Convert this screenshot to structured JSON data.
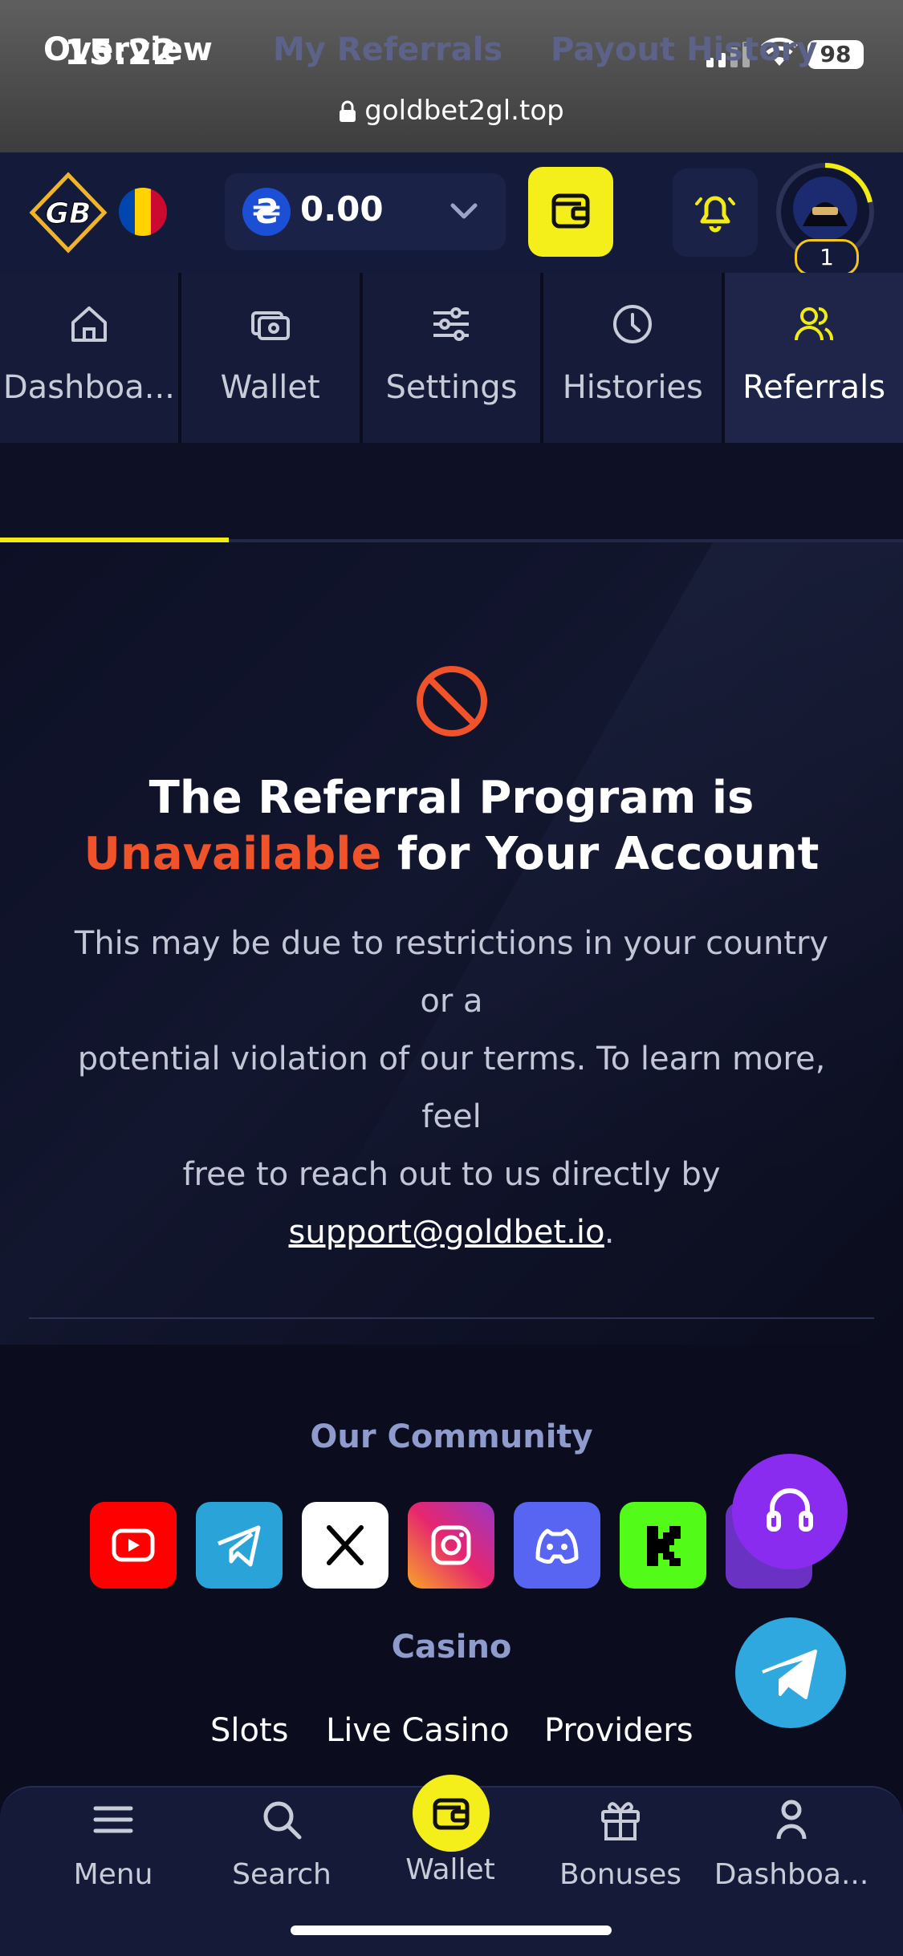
{
  "status": {
    "time": "15:22",
    "battery": "98",
    "url": "goldbet2gl.top"
  },
  "header": {
    "balance": "0.00",
    "currency_symbol": "₴",
    "level": "1"
  },
  "nav_tabs": [
    {
      "label": "Dashboa..."
    },
    {
      "label": "Wallet"
    },
    {
      "label": "Settings"
    },
    {
      "label": "Histories"
    },
    {
      "label": "Referrals"
    }
  ],
  "sub_tabs": [
    {
      "label": "Overview"
    },
    {
      "label": "My Referrals"
    },
    {
      "label": "Payout History"
    }
  ],
  "notice": {
    "title_line1": "The Referral Program is",
    "title_highlight": "Unavailable",
    "title_rest": " for Your Account",
    "desc_line1": "This may be due to restrictions in your country or a",
    "desc_line2": "potential violation of our terms. To learn more, feel",
    "desc_line3": "free to reach out to us directly by",
    "email": "support@goldbet.io",
    "email_suffix": "."
  },
  "footer": {
    "community_title": "Our Community",
    "casino_title": "Casino",
    "casino_links": [
      "Slots",
      "Live Casino",
      "Providers"
    ]
  },
  "bottom_nav": [
    {
      "label": "Menu"
    },
    {
      "label": "Search"
    },
    {
      "label": "Wallet"
    },
    {
      "label": "Bonuses"
    },
    {
      "label": "Dashboa..."
    }
  ],
  "colors": {
    "accent": "#f2ec13",
    "danger": "#f0522a",
    "bg": "#0b0d1e"
  }
}
